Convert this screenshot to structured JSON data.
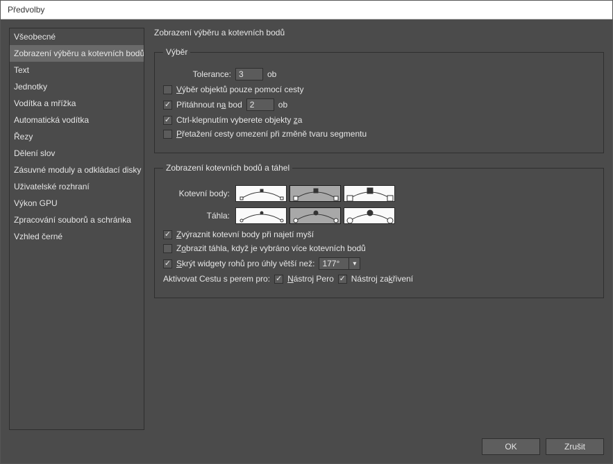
{
  "window": {
    "title": "Předvolby"
  },
  "sidebar": {
    "items": [
      {
        "label": "Všeobecné"
      },
      {
        "label": "Zobrazení výběru a kotevních bodů"
      },
      {
        "label": "Text"
      },
      {
        "label": "Jednotky"
      },
      {
        "label": "Vodítka a mřížka"
      },
      {
        "label": "Automatická vodítka"
      },
      {
        "label": "Řezy"
      },
      {
        "label": "Dělení slov"
      },
      {
        "label": "Zásuvné moduly a odkládací disky"
      },
      {
        "label": "Uživatelské rozhraní"
      },
      {
        "label": "Výkon GPU"
      },
      {
        "label": "Zpracování souborů a schránka"
      },
      {
        "label": "Vzhled černé"
      }
    ],
    "selected_index": 1
  },
  "content": {
    "heading": "Zobrazení výběru a kotevních bodů",
    "selection": {
      "legend": "Výběr",
      "tolerance_label": "Tolerance:",
      "tolerance_value": "3",
      "tolerance_unit": "ob",
      "path_only": {
        "checked": false,
        "label": "Výběr objektů pouze pomocí cesty"
      },
      "snap": {
        "checked": true,
        "label": "Přitáhnout na bod",
        "value": "2",
        "unit": "ob"
      },
      "ctrl_click": {
        "checked": true,
        "label": "Ctrl-klepnutím vyberete objekty za"
      },
      "drag_constrain": {
        "checked": false,
        "label": "Přetažení cesty omezení při změně tvaru segmentu"
      }
    },
    "anchors": {
      "legend": "Zobrazení kotevních bodů a táhel",
      "anchor_label": "Kotevní body:",
      "anchor_selected": 1,
      "handles_label": "Táhla:",
      "handles_selected": 1,
      "highlight": {
        "checked": true,
        "label": "Zvýraznit kotevní body při najetí myší"
      },
      "show_handles_multi": {
        "checked": false,
        "label": "Zobrazit táhla, když je vybráno více kotevních bodů"
      },
      "hide_corner": {
        "checked": true,
        "label": "Skrýt widgety rohů pro úhly větší než:",
        "value": "177°"
      },
      "rubber_band_label": "Aktivovat Cestu s perem pro:",
      "rb_pen": {
        "checked": true,
        "label": "Nástroj Pero"
      },
      "rb_curve": {
        "checked": true,
        "label": "Nástroj zakřivení"
      }
    }
  },
  "buttons": {
    "ok": "OK",
    "cancel": "Zrušit"
  }
}
